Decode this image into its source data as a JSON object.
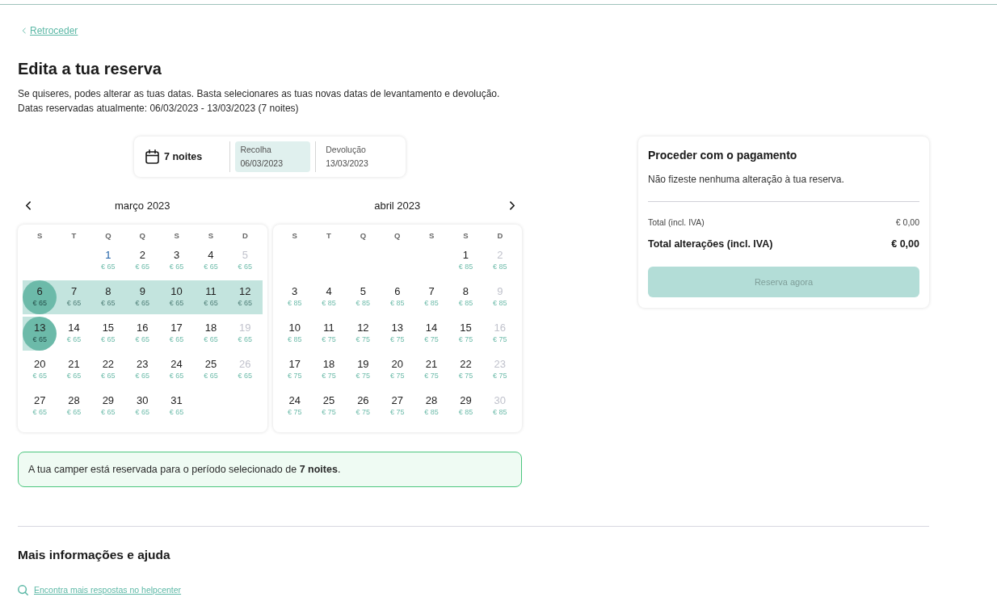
{
  "back_link": "Retroceder",
  "title": "Edita a tua reserva",
  "description": [
    "Se quiseres, podes alterar as tuas datas. Basta selecionares as tuas novas datas de levantamento e devolução.",
    "Datas reservadas atualmente: 06/03/2023 - 13/03/2023 (7 noites)"
  ],
  "date_picker": {
    "nights": "7 noites",
    "fields": [
      {
        "label": "Recolha",
        "value": "06/03/2023",
        "selected": true
      },
      {
        "label": "Devolução",
        "value": "13/03/2023",
        "selected": false
      }
    ]
  },
  "calendar": {
    "months": [
      {
        "title": "março 2023",
        "weekdays": [
          "S",
          "T",
          "Q",
          "Q",
          "S",
          "S",
          "D"
        ],
        "weeks": [
          [
            {
              "day": "1",
              "price": "€ 65",
              "selected": false,
              "in_range": false,
              "disabled": false,
              "today": true
            },
            {
              "day": "2",
              "price": "€ 65",
              "selected": false,
              "in_range": false,
              "disabled": false,
              "today": false
            },
            {
              "day": "3",
              "price": "€ 65",
              "selected": false,
              "in_range": false,
              "disabled": false,
              "today": false
            },
            {
              "day": "4",
              "price": "€ 65",
              "selected": false,
              "in_range": false,
              "disabled": false,
              "today": false
            },
            {
              "day": "5",
              "price": "€ 65",
              "selected": false,
              "in_range": false,
              "disabled": true,
              "today": false
            }
          ],
          [
            {
              "day": "6",
              "price": "€ 65",
              "selected": true,
              "in_range": true,
              "disabled": false,
              "today": false
            },
            {
              "day": "7",
              "price": "€ 65",
              "selected": false,
              "in_range": true,
              "disabled": false,
              "today": false
            },
            {
              "day": "8",
              "price": "€ 65",
              "selected": false,
              "in_range": true,
              "disabled": false,
              "today": false
            },
            {
              "day": "9",
              "price": "€ 65",
              "selected": false,
              "in_range": true,
              "disabled": false,
              "today": false
            },
            {
              "day": "10",
              "price": "€ 65",
              "selected": false,
              "in_range": true,
              "disabled": false,
              "today": false
            },
            {
              "day": "11",
              "price": "€ 65",
              "selected": false,
              "in_range": true,
              "disabled": false,
              "today": false
            },
            {
              "day": "12",
              "price": "€ 65",
              "selected": false,
              "in_range": true,
              "disabled": false,
              "today": false
            }
          ],
          [
            {
              "day": "13",
              "price": "€ 65",
              "selected": true,
              "in_range": false,
              "disabled": false,
              "today": false
            },
            {
              "day": "14",
              "price": "€ 65",
              "selected": false,
              "in_range": false,
              "disabled": false,
              "today": false
            },
            {
              "day": "15",
              "price": "€ 65",
              "selected": false,
              "in_range": false,
              "disabled": false,
              "today": false
            },
            {
              "day": "16",
              "price": "€ 65",
              "selected": false,
              "in_range": false,
              "disabled": false,
              "today": false
            },
            {
              "day": "17",
              "price": "€ 65",
              "selected": false,
              "in_range": false,
              "disabled": false,
              "today": false
            },
            {
              "day": "18",
              "price": "€ 65",
              "selected": false,
              "in_range": false,
              "disabled": false,
              "today": false
            },
            {
              "day": "19",
              "price": "€ 65",
              "selected": false,
              "in_range": false,
              "disabled": true,
              "today": false
            }
          ],
          [
            {
              "day": "20",
              "price": "€ 65",
              "selected": false,
              "in_range": false,
              "disabled": false,
              "today": false
            },
            {
              "day": "21",
              "price": "€ 65",
              "selected": false,
              "in_range": false,
              "disabled": false,
              "today": false
            },
            {
              "day": "22",
              "price": "€ 65",
              "selected": false,
              "in_range": false,
              "disabled": false,
              "today": false
            },
            {
              "day": "23",
              "price": "€ 65",
              "selected": false,
              "in_range": false,
              "disabled": false,
              "today": false
            },
            {
              "day": "24",
              "price": "€ 65",
              "selected": false,
              "in_range": false,
              "disabled": false,
              "today": false
            },
            {
              "day": "25",
              "price": "€ 65",
              "selected": false,
              "in_range": false,
              "disabled": false,
              "today": false
            },
            {
              "day": "26",
              "price": "€ 65",
              "selected": false,
              "in_range": false,
              "disabled": true,
              "today": false
            }
          ],
          [
            {
              "day": "27",
              "price": "€ 65",
              "selected": false,
              "in_range": false,
              "disabled": false,
              "today": false
            },
            {
              "day": "28",
              "price": "€ 65",
              "selected": false,
              "in_range": false,
              "disabled": false,
              "today": false
            },
            {
              "day": "29",
              "price": "€ 65",
              "selected": false,
              "in_range": false,
              "disabled": false,
              "today": false
            },
            {
              "day": "30",
              "price": "€ 65",
              "selected": false,
              "in_range": false,
              "disabled": false,
              "today": false
            },
            {
              "day": "31",
              "price": "€ 65",
              "selected": false,
              "in_range": false,
              "disabled": false,
              "today": false
            }
          ]
        ]
      },
      {
        "title": "abril 2023",
        "weekdays": [
          "S",
          "T",
          "Q",
          "Q",
          "S",
          "S",
          "D"
        ],
        "weeks": [
          [
            {
              "day": "1",
              "price": "€ 85",
              "selected": false,
              "in_range": false,
              "disabled": false,
              "today": false
            },
            {
              "day": "2",
              "price": "€ 85",
              "selected": false,
              "in_range": false,
              "disabled": true,
              "today": false
            }
          ],
          [
            {
              "day": "3",
              "price": "€ 85",
              "selected": false,
              "in_range": false,
              "disabled": false,
              "today": false
            },
            {
              "day": "4",
              "price": "€ 85",
              "selected": false,
              "in_range": false,
              "disabled": false,
              "today": false
            },
            {
              "day": "5",
              "price": "€ 85",
              "selected": false,
              "in_range": false,
              "disabled": false,
              "today": false
            },
            {
              "day": "6",
              "price": "€ 85",
              "selected": false,
              "in_range": false,
              "disabled": false,
              "today": false
            },
            {
              "day": "7",
              "price": "€ 85",
              "selected": false,
              "in_range": false,
              "disabled": false,
              "today": false
            },
            {
              "day": "8",
              "price": "€ 85",
              "selected": false,
              "in_range": false,
              "disabled": false,
              "today": false
            },
            {
              "day": "9",
              "price": "€ 85",
              "selected": false,
              "in_range": false,
              "disabled": true,
              "today": false
            }
          ],
          [
            {
              "day": "10",
              "price": "€ 85",
              "selected": false,
              "in_range": false,
              "disabled": false,
              "today": false
            },
            {
              "day": "11",
              "price": "€ 75",
              "selected": false,
              "in_range": false,
              "disabled": false,
              "today": false
            },
            {
              "day": "12",
              "price": "€ 75",
              "selected": false,
              "in_range": false,
              "disabled": false,
              "today": false
            },
            {
              "day": "13",
              "price": "€ 75",
              "selected": false,
              "in_range": false,
              "disabled": false,
              "today": false
            },
            {
              "day": "14",
              "price": "€ 75",
              "selected": false,
              "in_range": false,
              "disabled": false,
              "today": false
            },
            {
              "day": "15",
              "price": "€ 75",
              "selected": false,
              "in_range": false,
              "disabled": false,
              "today": false
            },
            {
              "day": "16",
              "price": "€ 75",
              "selected": false,
              "in_range": false,
              "disabled": true,
              "today": false
            }
          ],
          [
            {
              "day": "17",
              "price": "€ 75",
              "selected": false,
              "in_range": false,
              "disabled": false,
              "today": false
            },
            {
              "day": "18",
              "price": "€ 75",
              "selected": false,
              "in_range": false,
              "disabled": false,
              "today": false
            },
            {
              "day": "19",
              "price": "€ 75",
              "selected": false,
              "in_range": false,
              "disabled": false,
              "today": false
            },
            {
              "day": "20",
              "price": "€ 75",
              "selected": false,
              "in_range": false,
              "disabled": false,
              "today": false
            },
            {
              "day": "21",
              "price": "€ 75",
              "selected": false,
              "in_range": false,
              "disabled": false,
              "today": false
            },
            {
              "day": "22",
              "price": "€ 75",
              "selected": false,
              "in_range": false,
              "disabled": false,
              "today": false
            },
            {
              "day": "23",
              "price": "€ 75",
              "selected": false,
              "in_range": false,
              "disabled": true,
              "today": false
            }
          ],
          [
            {
              "day": "24",
              "price": "€ 75",
              "selected": false,
              "in_range": false,
              "disabled": false,
              "today": false
            },
            {
              "day": "25",
              "price": "€ 75",
              "selected": false,
              "in_range": false,
              "disabled": false,
              "today": false
            },
            {
              "day": "26",
              "price": "€ 75",
              "selected": false,
              "in_range": false,
              "disabled": false,
              "today": false
            },
            {
              "day": "27",
              "price": "€ 75",
              "selected": false,
              "in_range": false,
              "disabled": false,
              "today": false
            },
            {
              "day": "28",
              "price": "€ 85",
              "selected": false,
              "in_range": false,
              "disabled": false,
              "today": false
            },
            {
              "day": "29",
              "price": "€ 85",
              "selected": false,
              "in_range": false,
              "disabled": false,
              "today": false
            },
            {
              "day": "30",
              "price": "€ 85",
              "selected": false,
              "in_range": false,
              "disabled": true,
              "today": false
            }
          ]
        ]
      }
    ]
  },
  "notice": "A tua camper está reservada para o período selecionado de **7 noites**.",
  "payment": {
    "title": "Proceder com o pagamento",
    "message": "Não fizeste nenhuma alteração à tua reserva.",
    "rows": [
      {
        "kind": "subtotal",
        "label": "Total (incl. IVA)",
        "value": "€ 0,00"
      },
      {
        "kind": "total",
        "label": "Total alterações (incl. IVA)",
        "value": "€ 0,00"
      }
    ],
    "button": {
      "label": "Reserva agora",
      "disabled": true
    }
  },
  "help": {
    "title": "Mais informações e ajuda",
    "link": "Encontra mais respostas no helpcenter"
  }
}
